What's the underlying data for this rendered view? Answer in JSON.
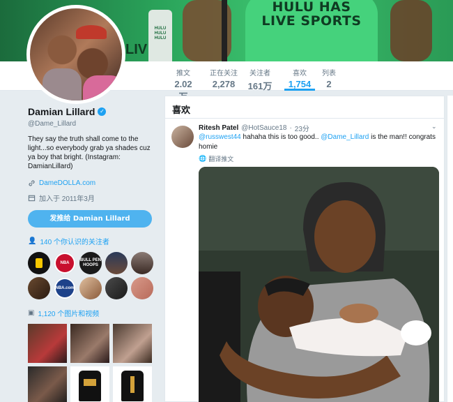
{
  "banner": {
    "shirt_text": "HULU HAS LIVE SPORTS",
    "bottle_text": "HULU HULU HULU",
    "side_text": "LIV"
  },
  "nav": {
    "stats": [
      {
        "label": "推文",
        "value": "2.02万",
        "active": false
      },
      {
        "label": "正在关注",
        "value": "2,278",
        "active": false
      },
      {
        "label": "关注者",
        "value": "161万",
        "active": false
      },
      {
        "label": "喜欢",
        "value": "1,754",
        "active": true
      },
      {
        "label": "列表",
        "value": "2",
        "active": false
      }
    ]
  },
  "profile": {
    "name": "Damian Lillard",
    "handle": "@Dame_Lillard",
    "bio": "They say the truth shall come to the light...so everybody grab ya shades cuz ya boy that bright. (Instagram: DamianLillard)",
    "website": "DameDOLLA.com",
    "joined": "加入于 2011年3月",
    "tweet_to_button": "发推给 Damian Lillard",
    "followers_you_know": "140 个你认识的关注者",
    "photos_videos": "1,120 个图片和视频",
    "follower_avatars": [
      {
        "text": "",
        "bg": "#111111"
      },
      {
        "text": "NBA",
        "bg": "#c8102e"
      },
      {
        "text": "BULL PEN HOOPS",
        "bg": "#1a1a1a"
      },
      {
        "text": "",
        "bg": "#2a3a5a"
      },
      {
        "text": "",
        "bg": "#5a4a44"
      },
      {
        "text": "",
        "bg": "#3a2a20"
      },
      {
        "text": "NBA.com",
        "bg": "#1d428a"
      },
      {
        "text": "",
        "bg": "#c88a5a"
      },
      {
        "text": "",
        "bg": "#2a2a2a"
      },
      {
        "text": "",
        "bg": "#b86a5a"
      }
    ]
  },
  "likes": {
    "title": "喜欢",
    "tweet": {
      "name": "Ritesh Patel",
      "screen_name": "@HotSauce18",
      "dot": "·",
      "time": "23分",
      "mention1": "@russwest44",
      "text1": " hahaha this is too good.. ",
      "mention2": "@Dame_Lillard",
      "text2": " is the man!! congrats homie",
      "translate": "翻译推文"
    }
  }
}
